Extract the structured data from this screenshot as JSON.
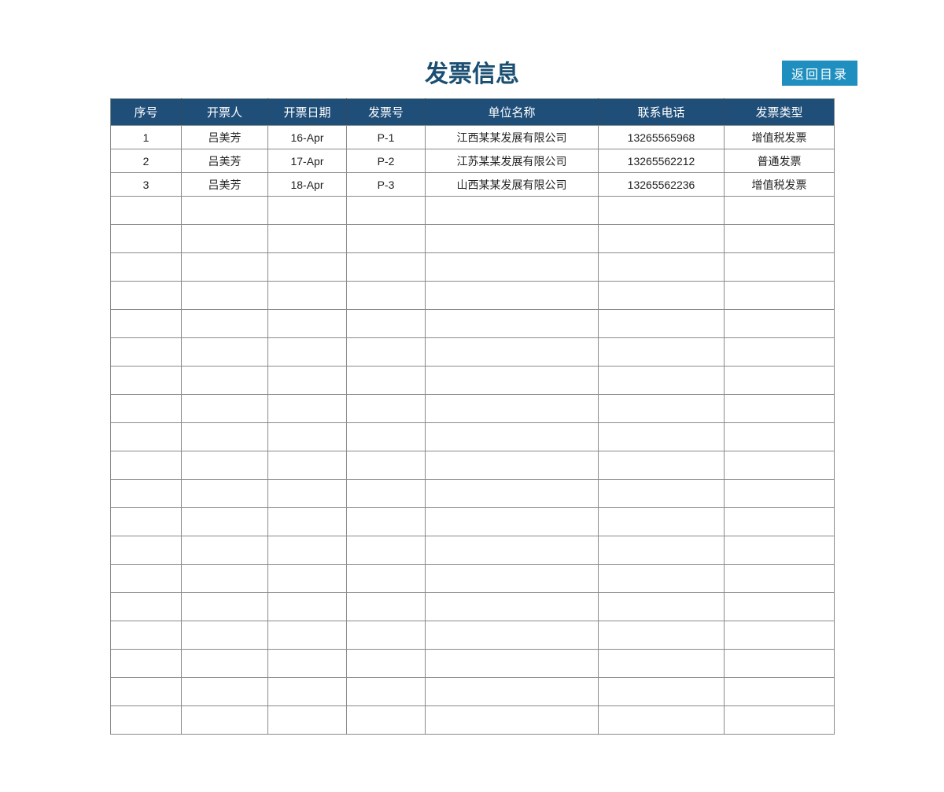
{
  "title": "发票信息",
  "back_button": "返回目录",
  "columns": {
    "seq": "序号",
    "issuer": "开票人",
    "date": "开票日期",
    "no": "发票号",
    "unit": "单位名称",
    "phone": "联系电话",
    "type": "发票类型"
  },
  "rows": [
    {
      "seq": "1",
      "issuer": "吕美芳",
      "date": "16-Apr",
      "no": "P-1",
      "unit": "江西某某发展有限公司",
      "phone": "13265565968",
      "type": "增值税发票"
    },
    {
      "seq": "2",
      "issuer": "吕美芳",
      "date": "17-Apr",
      "no": "P-2",
      "unit": "江苏某某发展有限公司",
      "phone": "13265562212",
      "type": "普通发票"
    },
    {
      "seq": "3",
      "issuer": "吕美芳",
      "date": "18-Apr",
      "no": "P-3",
      "unit": "山西某某发展有限公司",
      "phone": "13265562236",
      "type": "增值税发票"
    }
  ],
  "empty_row_count": 19
}
